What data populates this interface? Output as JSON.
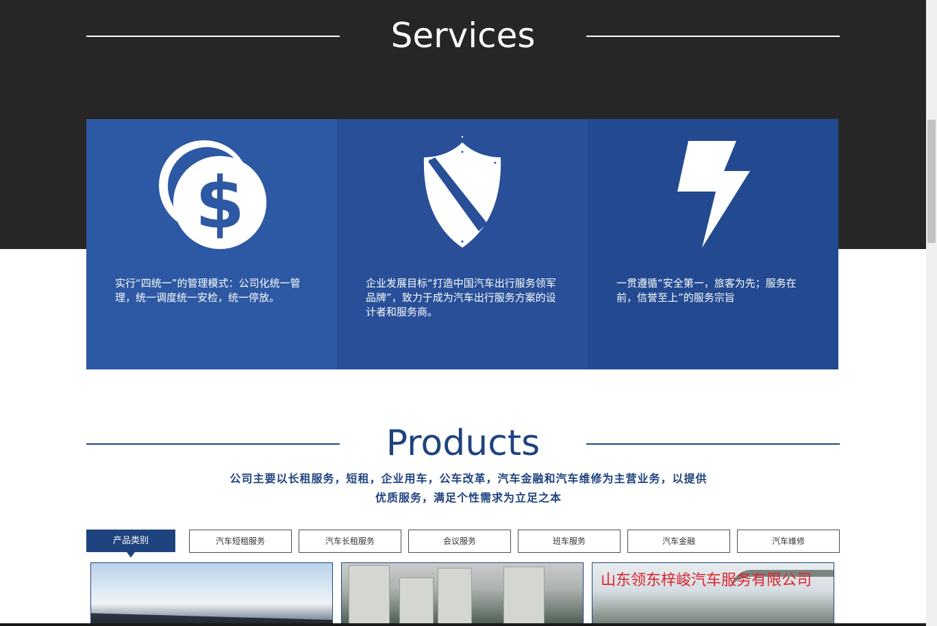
{
  "services": {
    "title": "Services",
    "cards": [
      {
        "icon": "dollar-coin-icon",
        "text": "实行“四统一”的管理模式：公司化统一管理，统一调度统一安检，统一停放。"
      },
      {
        "icon": "shield-icon",
        "text": "企业发展目标“打造中国汽车出行服务领军品牌”，致力于成为汽车出行服务方案的设计者和服务商。"
      },
      {
        "icon": "lightning-icon",
        "text": "一贯遵循“安全第一，旅客为先；服务在前，信誉至上”的服务宗旨"
      }
    ]
  },
  "products": {
    "title": "Products",
    "intro_line1": "公司主要以长租服务，短租，企业用车，公车改革，汽车金融和汽车维修为主营业务，以提供",
    "intro_line2": "优质服务，满足个性需求为立足之本",
    "active_tab": "产品类别",
    "tabs": [
      "汽车短租服务",
      "汽车长租服务",
      "会议服务",
      "班车服务",
      "汽车金融",
      "汽车维修"
    ],
    "image3_caption": "山东领东梓峻汽车服务有限公司"
  },
  "colors": {
    "brand_blue": "#1f437f",
    "dark_band": "#262626",
    "card_blue": "#2d58a3"
  }
}
